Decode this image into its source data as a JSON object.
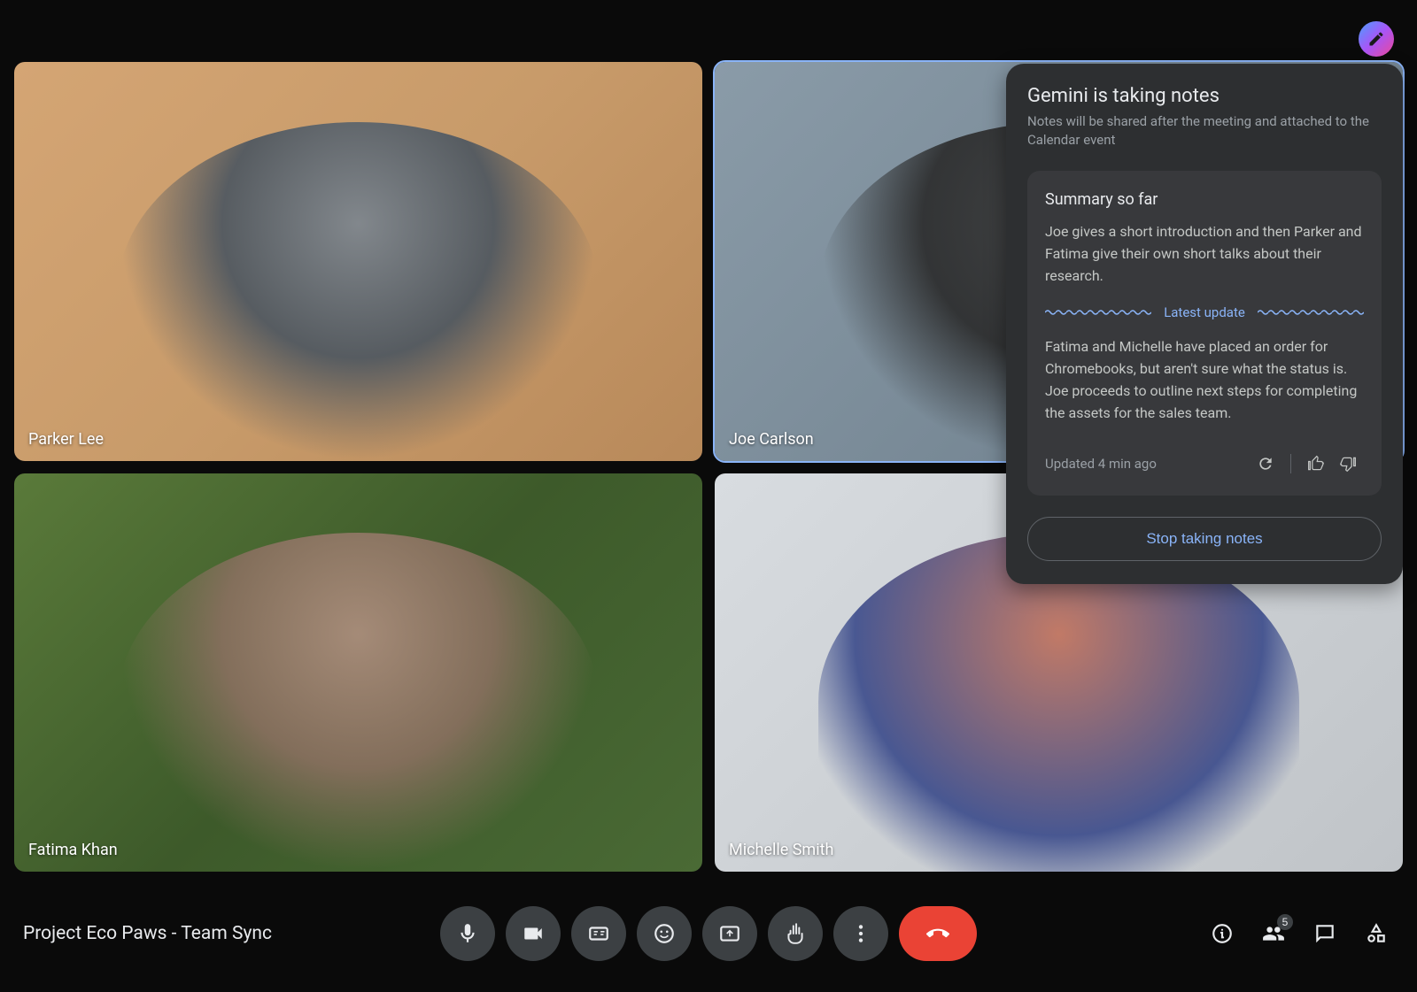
{
  "participants": [
    {
      "name": "Parker Lee"
    },
    {
      "name": "Joe Carlson"
    },
    {
      "name": "Fatima Khan"
    },
    {
      "name": "Michelle Smith"
    }
  ],
  "gemini": {
    "title": "Gemini is taking notes",
    "subtitle": "Notes will be shared after the meeting and attached to the Calendar event",
    "summary_header": "Summary so far",
    "summary_intro": "Joe gives a short introduction and then Parker and Fatima give their own short talks about their research.",
    "latest_label": "Latest update",
    "latest_text": "Fatima and Michelle have placed an order for Chromebooks, but aren't sure what the status is. Joe proceeds to outline next steps for completing the assets for the sales team.",
    "updated_text": "Updated 4 min ago",
    "stop_label": "Stop taking notes"
  },
  "meeting": {
    "title": "Project Eco Paws - Team Sync",
    "participant_count": "5"
  }
}
